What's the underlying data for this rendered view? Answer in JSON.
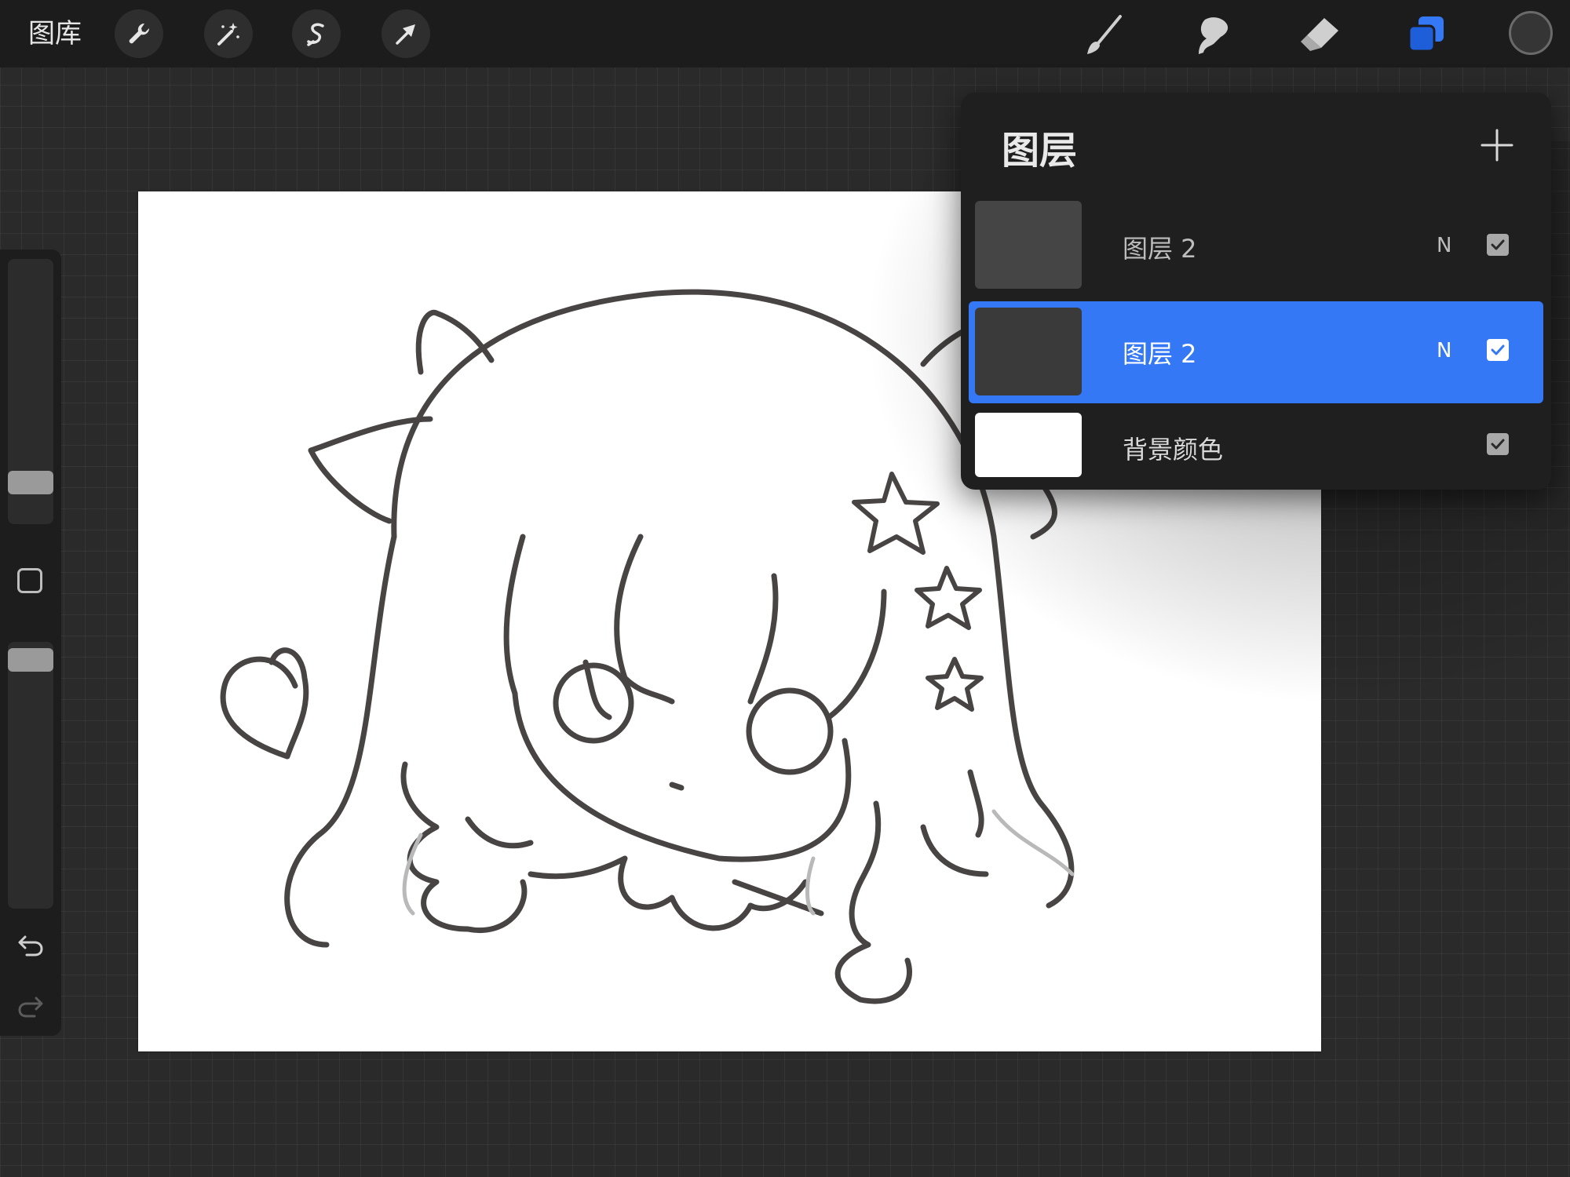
{
  "toolbar": {
    "gallery_label": "图库",
    "left_tools": [
      {
        "icon": "wrench-icon",
        "name": "actions"
      },
      {
        "icon": "magic-wand-icon",
        "name": "adjustments"
      },
      {
        "icon": "selection-icon",
        "name": "selection"
      },
      {
        "icon": "transform-arrow-icon",
        "name": "transform"
      }
    ],
    "right_tools": [
      {
        "icon": "brush-icon",
        "name": "paint"
      },
      {
        "icon": "smudge-icon",
        "name": "smudge"
      },
      {
        "icon": "eraser-icon",
        "name": "erase"
      },
      {
        "icon": "layers-icon",
        "name": "layers"
      }
    ],
    "active_tool_color": "#3478f6",
    "current_color": "#353535"
  },
  "sidebar": {
    "brush_size_level": 0.17,
    "opacity_level": 1.0,
    "buttons": [
      "modify-button",
      "undo-icon",
      "redo-icon"
    ]
  },
  "layers_panel": {
    "title": "图层",
    "add_icon": "plus-icon",
    "layers": [
      {
        "name": "图层 2",
        "blend": "N",
        "visible": true,
        "selected": false
      },
      {
        "name": "图层 2",
        "blend": "N",
        "visible": true,
        "selected": true
      },
      {
        "name": "背景颜色",
        "blend": "",
        "visible": true,
        "selected": false
      }
    ]
  }
}
